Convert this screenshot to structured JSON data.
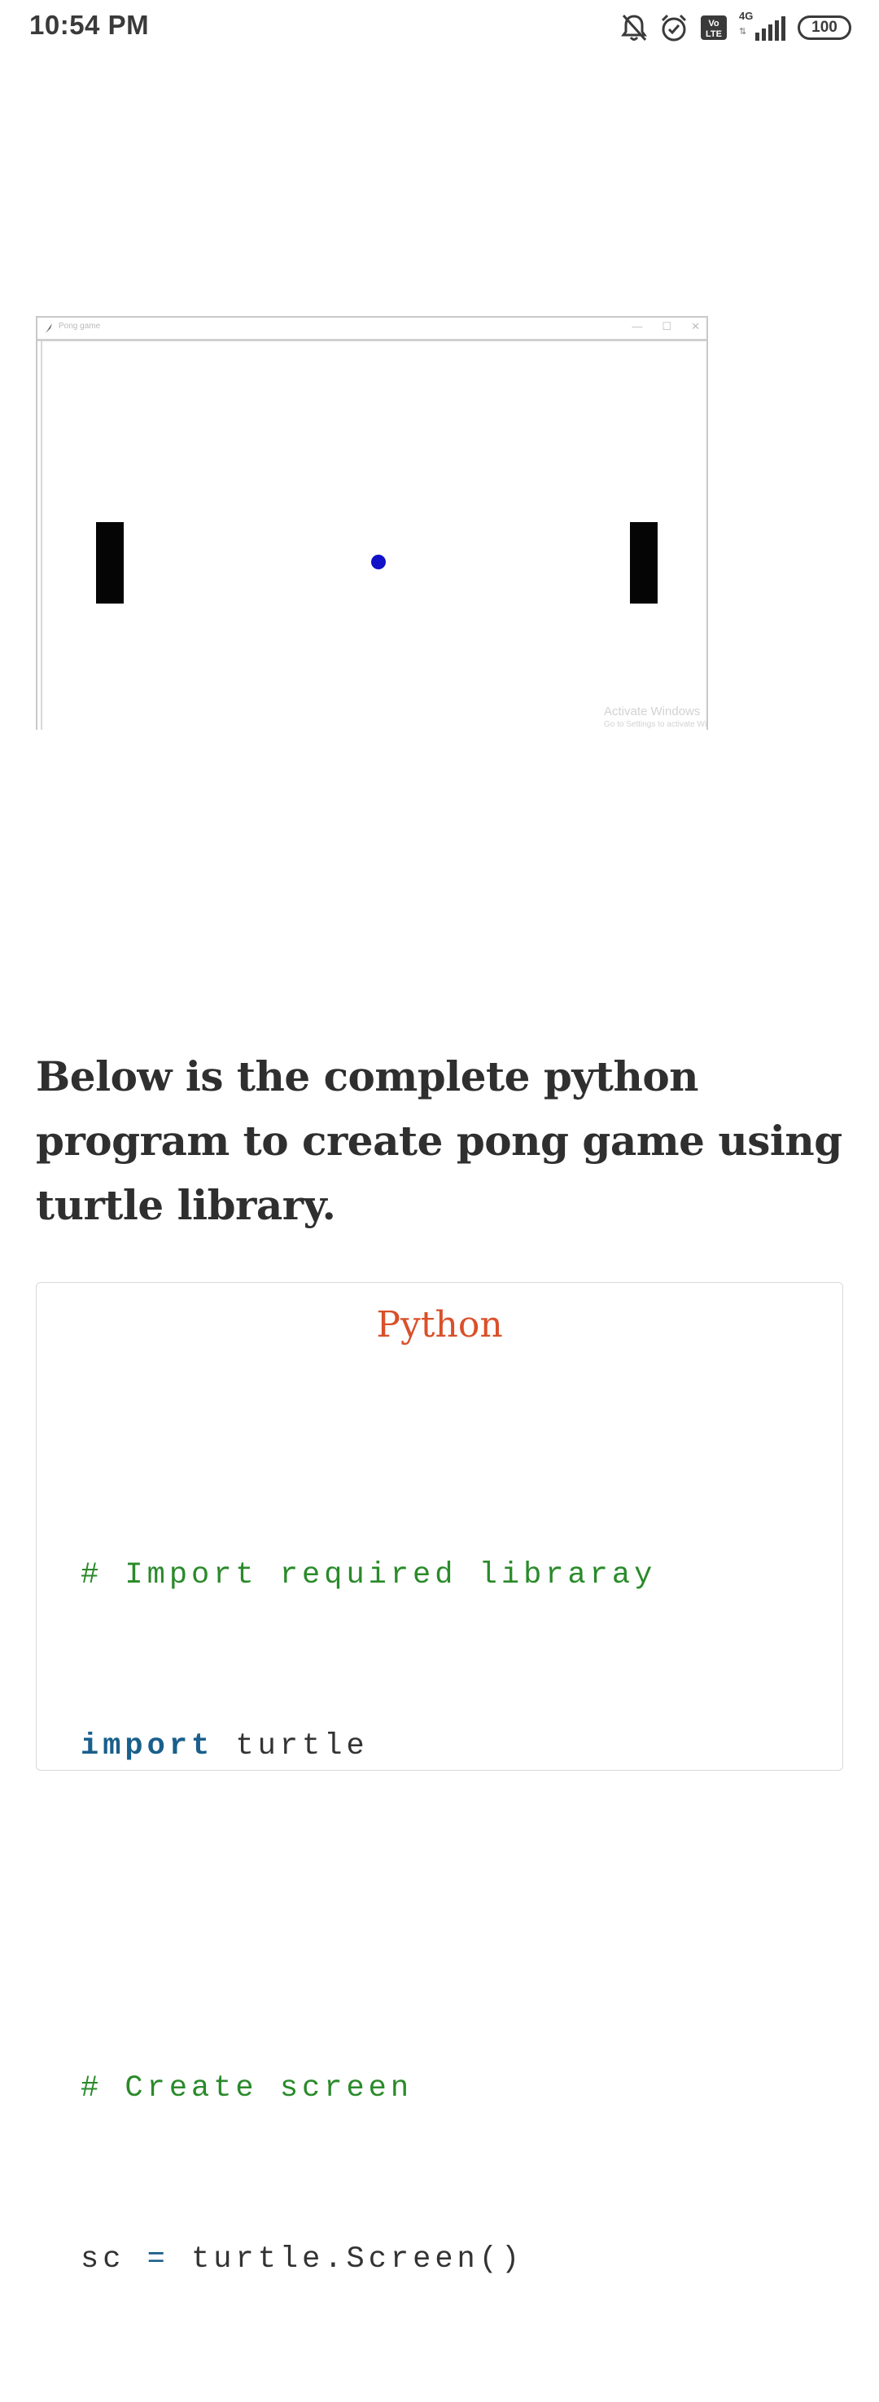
{
  "status_bar": {
    "time": "10:54 PM",
    "network": "4G",
    "volte": "Vo LTE",
    "battery": "100",
    "icons": [
      "bell-off-icon",
      "alarm-clock-icon",
      "volte-icon",
      "signal-icon",
      "battery-icon"
    ]
  },
  "pong_window": {
    "title": "Pong game",
    "controls": [
      "—",
      "☐",
      "✕"
    ],
    "watermark_title": "Activate Windows",
    "watermark_sub": "Go to Settings to activate Windows."
  },
  "article": {
    "heading": "Below is the complete python program to create pong game using turtle library."
  },
  "code": {
    "language": "Python",
    "lines": [
      {
        "comment": "# Import required libraray"
      },
      {
        "keyword": "import",
        "rest": " turtle"
      },
      {
        "blank": ""
      },
      {
        "comment": "# Create screen"
      },
      {
        "var": "sc",
        "op": "=",
        "rest": "turtle.Screen()"
      }
    ]
  },
  "colors": {
    "heading": "#2f2f2f",
    "code_language": "#d9502a",
    "code_comment": "#2a8a2a",
    "code_keyword": "#1a5f8c",
    "ball": "#1111c8",
    "paddle": "#050505"
  }
}
